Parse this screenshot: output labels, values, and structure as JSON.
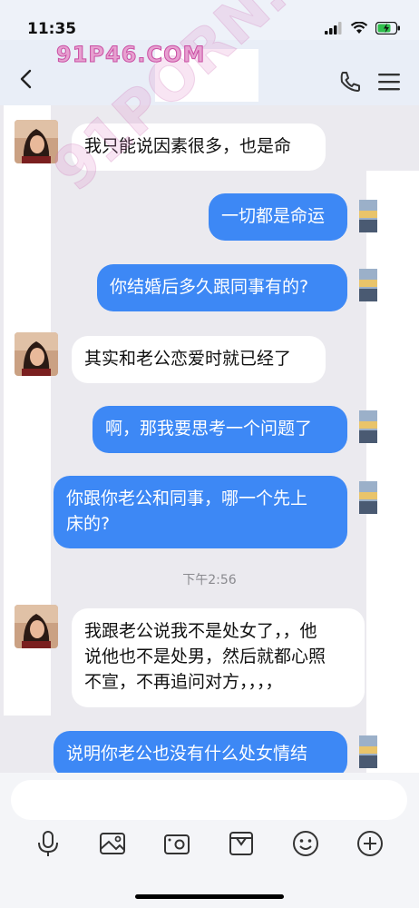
{
  "status": {
    "time": "11:35"
  },
  "watermark": {
    "top": "91P46.COM",
    "diagonal": "91PORN.COM"
  },
  "nav": {
    "back_icon": "chevron-left-icon",
    "call_icon": "phone-icon",
    "menu_icon": "hamburger-menu-icon"
  },
  "messages": [
    {
      "side": "in",
      "text": "我只能说因素很多，也是命"
    },
    {
      "side": "out",
      "text": "一切都是命运"
    },
    {
      "side": "out",
      "text": "你结婚后多久跟同事有的?"
    },
    {
      "side": "in",
      "text": "其实和老公恋爱时就已经了"
    },
    {
      "side": "out",
      "text": "啊，那我要思考一个问题了"
    },
    {
      "side": "out",
      "text": "你跟你老公和同事，哪一个先上\n床的?"
    },
    {
      "side": "in",
      "text": "我跟老公说我不是处女了，，他\n说他也不是处男，然后就都心照\n不宣，不再追问对方，，，，"
    },
    {
      "side": "out",
      "text": "说明你老公也没有什么处女情结"
    }
  ],
  "timestamp": "下午2:56",
  "toolbar": {
    "icons": [
      "microphone-icon",
      "image-icon",
      "camera-icon",
      "box-icon",
      "emoji-icon",
      "plus-icon"
    ]
  },
  "colors": {
    "outgoing_bubble": "#3d88f5",
    "incoming_bubble": "#ffffff",
    "chat_background": "#ebeaef"
  }
}
